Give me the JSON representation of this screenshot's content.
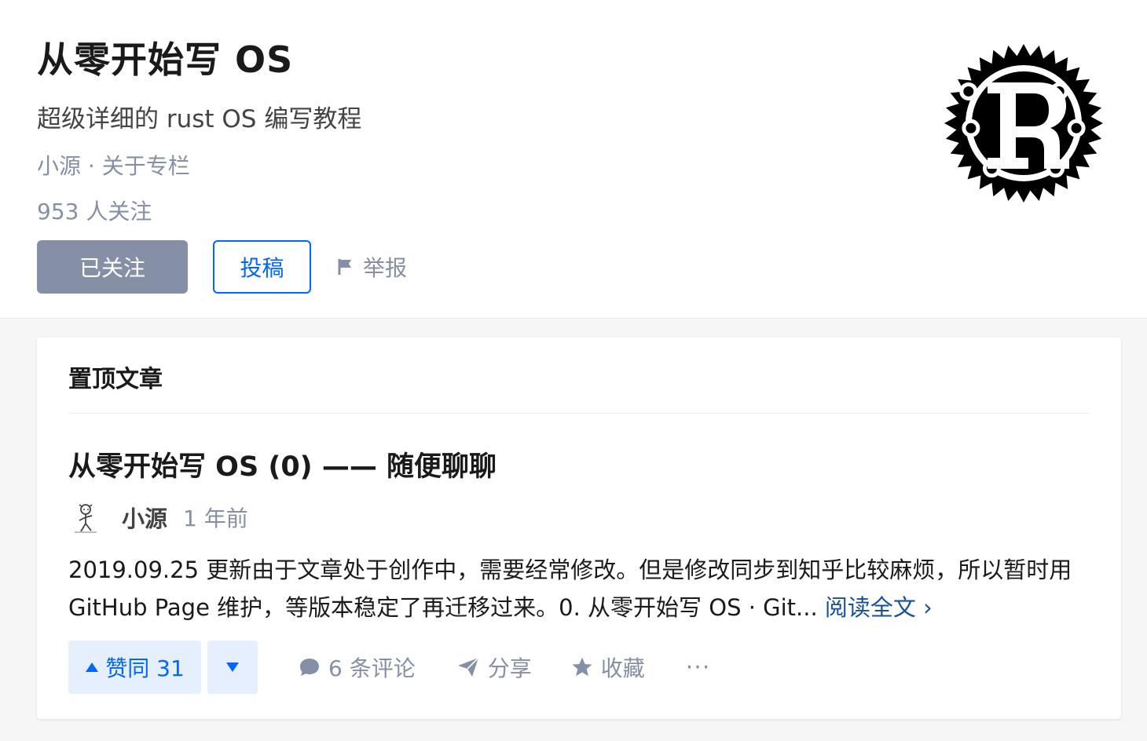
{
  "column": {
    "title": "从零开始写 OS",
    "description": "超级详细的 rust OS 编写教程",
    "author": "小源",
    "meta_separator": " · ",
    "about_label": "关于专栏",
    "followers": "953 人关注",
    "followed_button": "已关注",
    "submit_button": "投稿",
    "report_button": "举报",
    "logo_icon": "rust-logo-icon"
  },
  "pinned": {
    "section_label": "置顶文章",
    "article": {
      "title": "从零开始写 OS (0) —— 随便聊聊",
      "author": "小源",
      "time": "1 年前",
      "excerpt": "2019.09.25 更新由于文章处于创作中，需要经常修改。但是修改同步到知乎比较麻烦，所以暂时用 GitHub Page 维护，等版本稳定了再迁移过来。0. 从零开始写 OS · Git...",
      "read_more": "阅读全文 ›",
      "upvote_label": "赞同 31",
      "comments_label": "6 条评论",
      "share_label": "分享",
      "collect_label": "收藏",
      "more_label": "···"
    }
  },
  "colors": {
    "accent": "#0066ff",
    "muted": "#8590a6",
    "vote_bg": "#e5effe",
    "link": "#175199"
  }
}
